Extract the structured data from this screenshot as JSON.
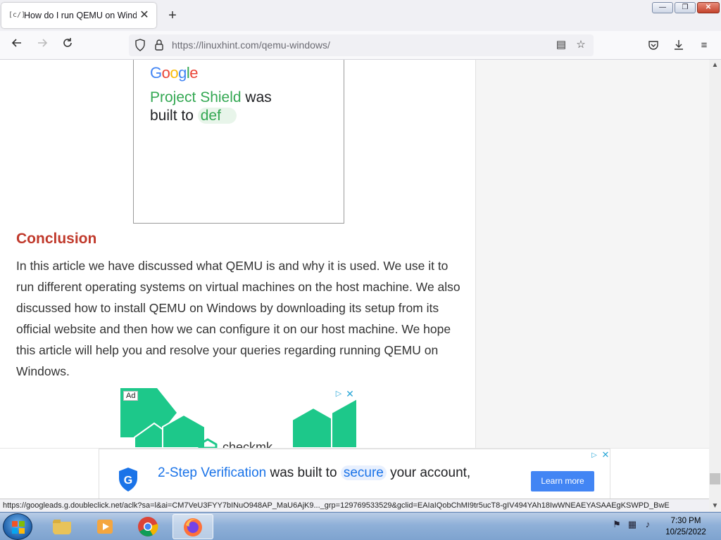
{
  "browser": {
    "tab_title": "How do I run QEMU on Windows",
    "tab_close": "✕",
    "new_tab": "+",
    "window_controls": {
      "minimize": "—",
      "maximize": "❐",
      "close": "✕"
    },
    "url_host": "https://linuxhint.com",
    "url_path": "/qemu-windows/"
  },
  "article_ad": {
    "logo": "Google",
    "line1_green": "Project Shield",
    "line1_rest": " was",
    "line2_text": "built to ",
    "line2_pill": "def"
  },
  "article": {
    "heading": "Conclusion",
    "paragraph": "In this article we have discussed what QEMU is and why it is used. We use it to run different operating systems on virtual machines on the host machine. We also discussed how to install QEMU on Windows by downloading its setup from its official website and then how we can configure it on our host machine. We hope this article will help you and resolve your queries regarding running QEMU on Windows."
  },
  "inline_ad": {
    "label": "Ad",
    "brand_fragment": "checkmk"
  },
  "anchor_ad": {
    "text_blue": "2-Step Verification",
    "text_mid": " was built to ",
    "pill": "secure",
    "text_end": " your account,",
    "button": "Learn more"
  },
  "status_url": "https://googleads.g.doubleclick.net/aclk?sa=l&ai=CM7VeU3FYY7bINuO948AP_MaU6AjK9..._grp=129769533529&gclid=EAIaIQobChMI9tr5ucT8-gIV494YAh18IwWNEAEYASAAEgKSWPD_BwE",
  "taskbar": {
    "clock_time": "7:30 PM",
    "clock_date": "10/25/2022"
  },
  "colors": {
    "heading": "#c0392b",
    "google_green": "#34a853",
    "google_blue": "#1a73e8",
    "button_blue": "#4285f4"
  }
}
